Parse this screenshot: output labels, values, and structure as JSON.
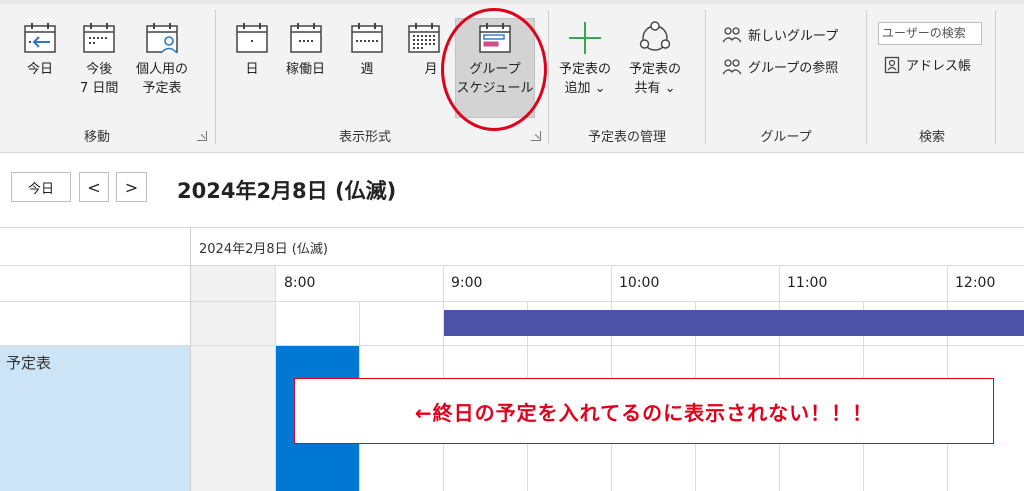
{
  "ribbon": {
    "move_group": {
      "label": "移動",
      "buttons": [
        {
          "label": "今日",
          "icon": "calendar-today-arrow-icon"
        },
        {
          "label": "今後\n7 日間",
          "icon": "calendar-next7-icon"
        },
        {
          "label": "個人用の\n予定表",
          "icon": "calendar-person-icon"
        }
      ]
    },
    "view_group": {
      "label": "表示形式",
      "buttons": [
        {
          "label": "日",
          "icon": "calendar-day-icon"
        },
        {
          "label": "稼働日",
          "icon": "calendar-workweek-icon"
        },
        {
          "label": "週",
          "icon": "calendar-week-icon"
        },
        {
          "label": "月",
          "icon": "calendar-month-icon"
        },
        {
          "label": "グループ\nスケジュール",
          "icon": "group-schedule-icon",
          "selected": true
        }
      ]
    },
    "manage_group": {
      "label": "予定表の管理",
      "buttons": [
        {
          "label": "予定表の\n追加 ⌄",
          "icon": "plus-icon"
        },
        {
          "label": "予定表の\n共有 ⌄",
          "icon": "share-icon"
        }
      ]
    },
    "groups_group": {
      "label": "グループ",
      "items": [
        {
          "label": "新しいグループ",
          "icon": "new-group-icon"
        },
        {
          "label": "グループの参照",
          "icon": "browse-groups-icon"
        }
      ]
    },
    "search_group": {
      "label": "検索",
      "search_text": "ユーザーの検索",
      "address_book": "アドレス帳"
    }
  },
  "nav": {
    "today": "今日",
    "prev": "<",
    "next": ">",
    "date_title": "2024年2月8日 (仏滅)"
  },
  "grid": {
    "date_header": "2024年2月8日 (仏滅)",
    "hours": [
      "8:00",
      "9:00",
      "10:00",
      "11:00",
      "12:00"
    ],
    "row_label": "予定表"
  },
  "annotation": "←終日の予定を入れてるのに表示されない！！！",
  "colors": {
    "accent_red": "#e0001b",
    "allday_bar": "#4b52a8",
    "busy_block": "#0078d4",
    "row_label_bg": "#cde4f7",
    "icon_blue": "#2b78c5",
    "icon_green": "#3aa757"
  }
}
